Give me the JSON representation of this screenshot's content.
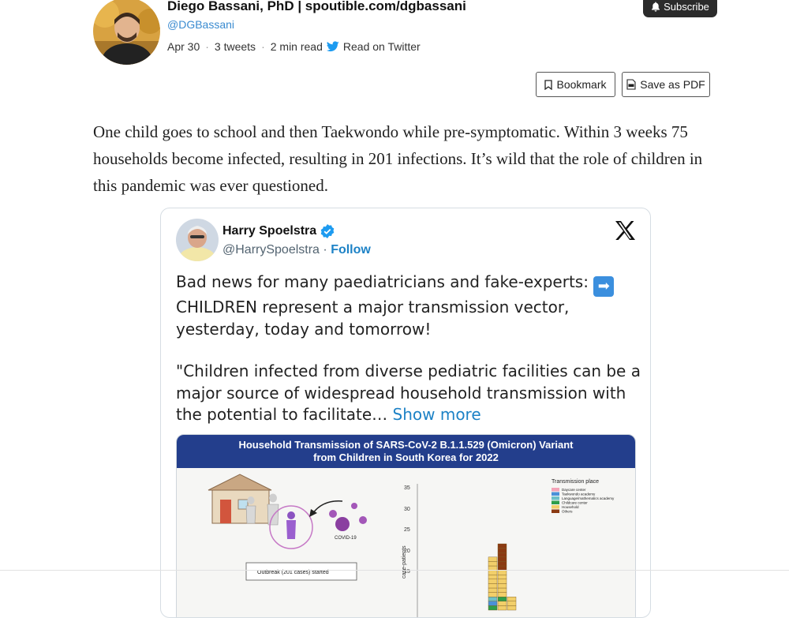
{
  "header": {
    "author_name": "Diego Bassani, PhD | spoutible.com/dgbassani",
    "author_handle": "@DGBassani",
    "date": "Apr 30",
    "tweet_count": "3 tweets",
    "read_time": "2 min read",
    "read_on_twitter": "Read on Twitter",
    "subscribe_label": "Subscribe"
  },
  "actions": {
    "bookmark_label": "Bookmark",
    "save_pdf_label": "Save as PDF"
  },
  "post": {
    "text": "One child goes to school and then Taekwondo while pre-symptomatic. Within 3 weeks 75 households become infected, resulting in 201 infections. It’s wild that the role of children in this pandemic was ever questioned."
  },
  "embedded_tweet": {
    "name": "Harry Spoelstra",
    "handle": "@HarrySpoelstra",
    "separator": "·",
    "follow_label": "Follow",
    "para1": "Bad news for many paediatricians and fake-experts:",
    "para1_rest": "CHILDREN represent a major transmission vector, yesterday, today and tomorrow!",
    "para2": "\"Children infected from diverse pediatric facilities can be a major source of widespread household transmission with the potential to facilitate…",
    "show_more": "Show more",
    "media": {
      "title_line1": "Household Transmission of SARS-CoV-2 B.1.1.529 (Omicron) Variant",
      "title_line2": "from Children in South Korea for 2022",
      "covid_label": "COVID-19",
      "outbreak_label": "Outbreak (201 cases) started",
      "chart_legend_title": "Transmission place",
      "legend_items": [
        "Daycare center",
        "Taekwondo academy",
        "Language/mathematics academy",
        "Childcare center",
        "Household",
        "Others"
      ],
      "y_axis_label": "case-patients",
      "y_ticks": [
        "35",
        "30",
        "25",
        "20",
        "15"
      ]
    }
  },
  "colors": {
    "accent": "#1d82c6",
    "media_header": "#233e8c",
    "legend": [
      "#f4a3b8",
      "#4a90d9",
      "#6cc0c8",
      "#2e9e4a",
      "#f2cf6a",
      "#8b3a12"
    ]
  }
}
